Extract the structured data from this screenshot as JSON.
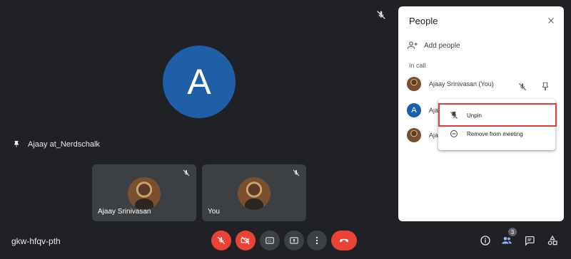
{
  "stage": {
    "pinned_participant_initial": "A",
    "pinned_participant_name": "Ajaay at_Nerdschalk"
  },
  "tiles": [
    {
      "label": "Ajaay Srinivasan"
    },
    {
      "label": "You"
    }
  ],
  "bottom_bar": {
    "meeting_code": "gkw-hfqv-pth",
    "people_count": "3"
  },
  "panel": {
    "title": "People",
    "add_people_label": "Add people",
    "section_label": "In call",
    "participants": [
      {
        "name": "Ajaay Srinivasan (You)",
        "avatar": "photo"
      },
      {
        "name": "Aja",
        "avatar": "A"
      },
      {
        "name": "Aja",
        "avatar": "photo"
      }
    ]
  },
  "menu": {
    "items": [
      {
        "label": "Unpin",
        "icon": "unpin-icon"
      },
      {
        "label": "Remove from meeting",
        "icon": "remove-circle-icon"
      }
    ]
  },
  "colors": {
    "background": "#202124",
    "accent_red": "#ea4335",
    "avatar_blue": "#1f5fa8",
    "highlight_red": "#e53935"
  }
}
